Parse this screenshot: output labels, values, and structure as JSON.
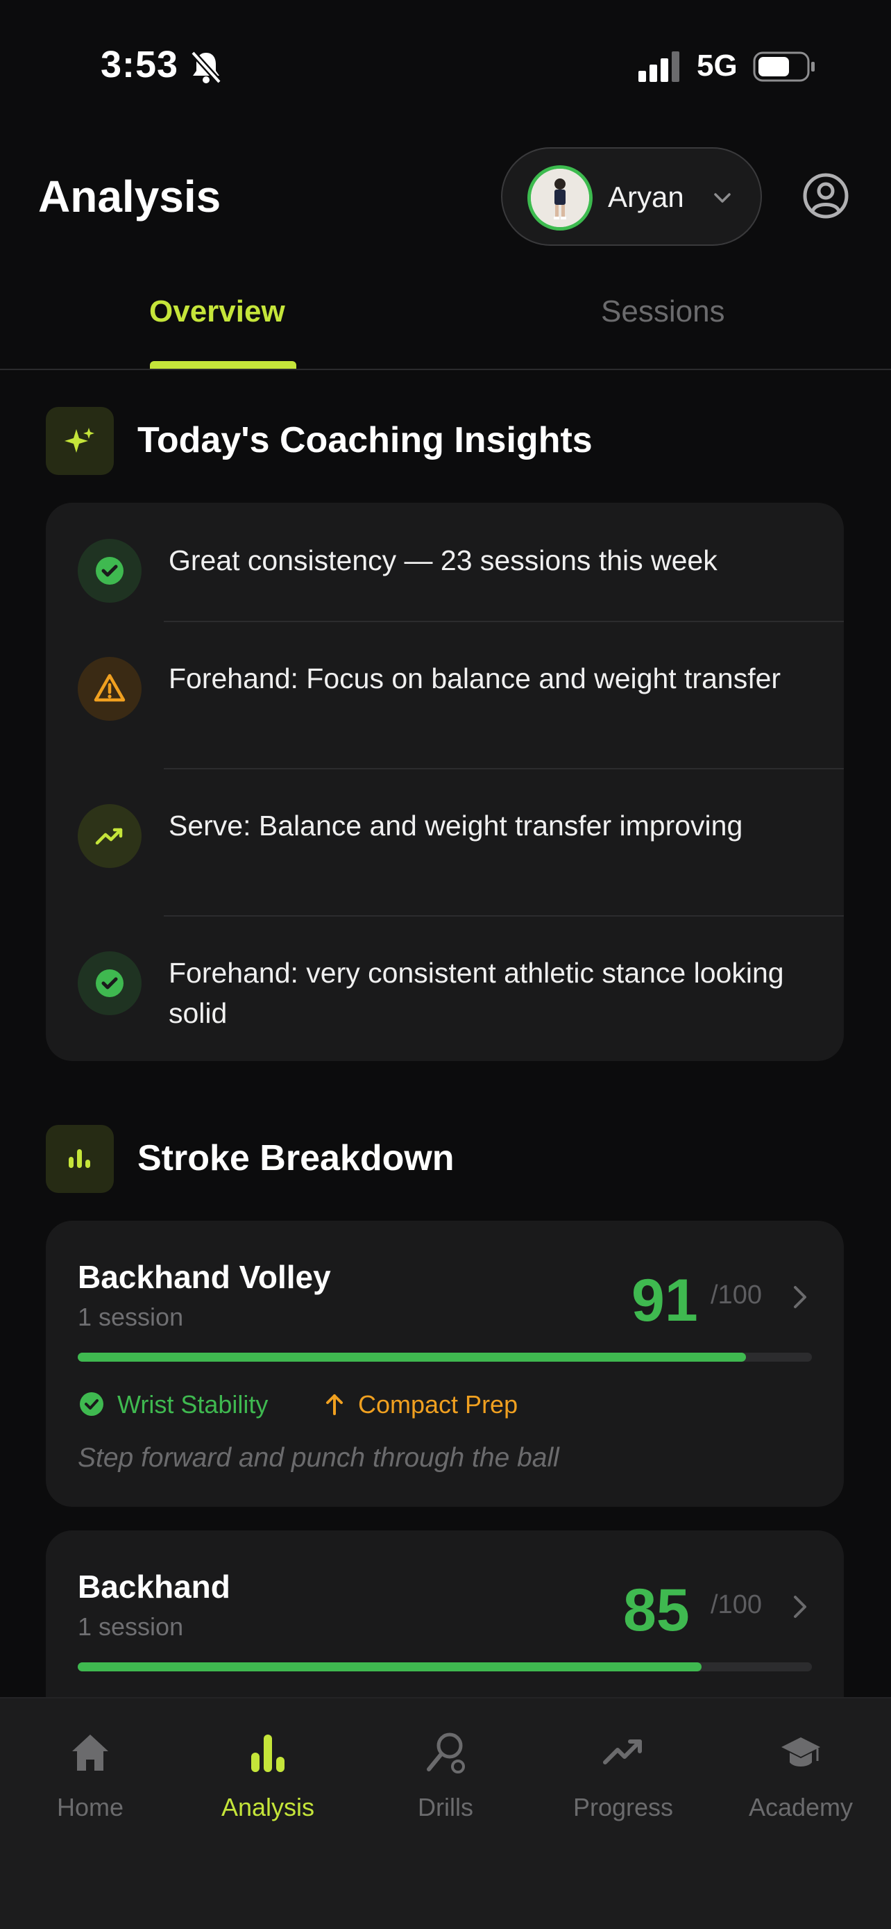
{
  "status_bar": {
    "time": "3:53",
    "network": "5G"
  },
  "header": {
    "title": "Analysis",
    "user_name": "Aryan"
  },
  "tabs": [
    {
      "label": "Overview",
      "active": true
    },
    {
      "label": "Sessions",
      "active": false
    }
  ],
  "insights": {
    "title": "Today's Coaching Insights",
    "items": [
      {
        "text": "Great consistency — 23 sessions this week",
        "icon": "check-circle-icon",
        "color": "#3fb950"
      },
      {
        "text": "Forehand: Focus on balance and weight transfer",
        "icon": "warning-icon",
        "color": "#f0a020"
      },
      {
        "text": "Serve: Balance and weight transfer improving",
        "icon": "trending-up-icon",
        "color": "#c5e53a"
      },
      {
        "text": "Forehand: very consistent athletic stance looking solid",
        "icon": "check-circle-icon",
        "color": "#3fb950"
      }
    ]
  },
  "stroke_breakdown": {
    "title": "Stroke Breakdown",
    "strokes": [
      {
        "name": "Backhand Volley",
        "sessions": "1 session",
        "score": "91",
        "score_max": "/100",
        "progress": 0.91,
        "strength": "Wrist Stability",
        "improve": "Compact Prep",
        "tip": "Step forward and punch through the ball"
      },
      {
        "name": "Backhand",
        "sessions": "1 session",
        "score": "85",
        "score_max": "/100",
        "progress": 0.85
      }
    ]
  },
  "nav": [
    {
      "label": "Home",
      "icon": "home-icon",
      "active": false
    },
    {
      "label": "Analysis",
      "icon": "bar-chart-icon",
      "active": true
    },
    {
      "label": "Drills",
      "icon": "racket-icon",
      "active": false
    },
    {
      "label": "Progress",
      "icon": "trending-up-icon",
      "active": false
    },
    {
      "label": "Academy",
      "icon": "graduation-cap-icon",
      "active": false
    }
  ],
  "colors": {
    "accent": "#c5e53a",
    "success": "#3fb950",
    "warning": "#f0a020"
  }
}
